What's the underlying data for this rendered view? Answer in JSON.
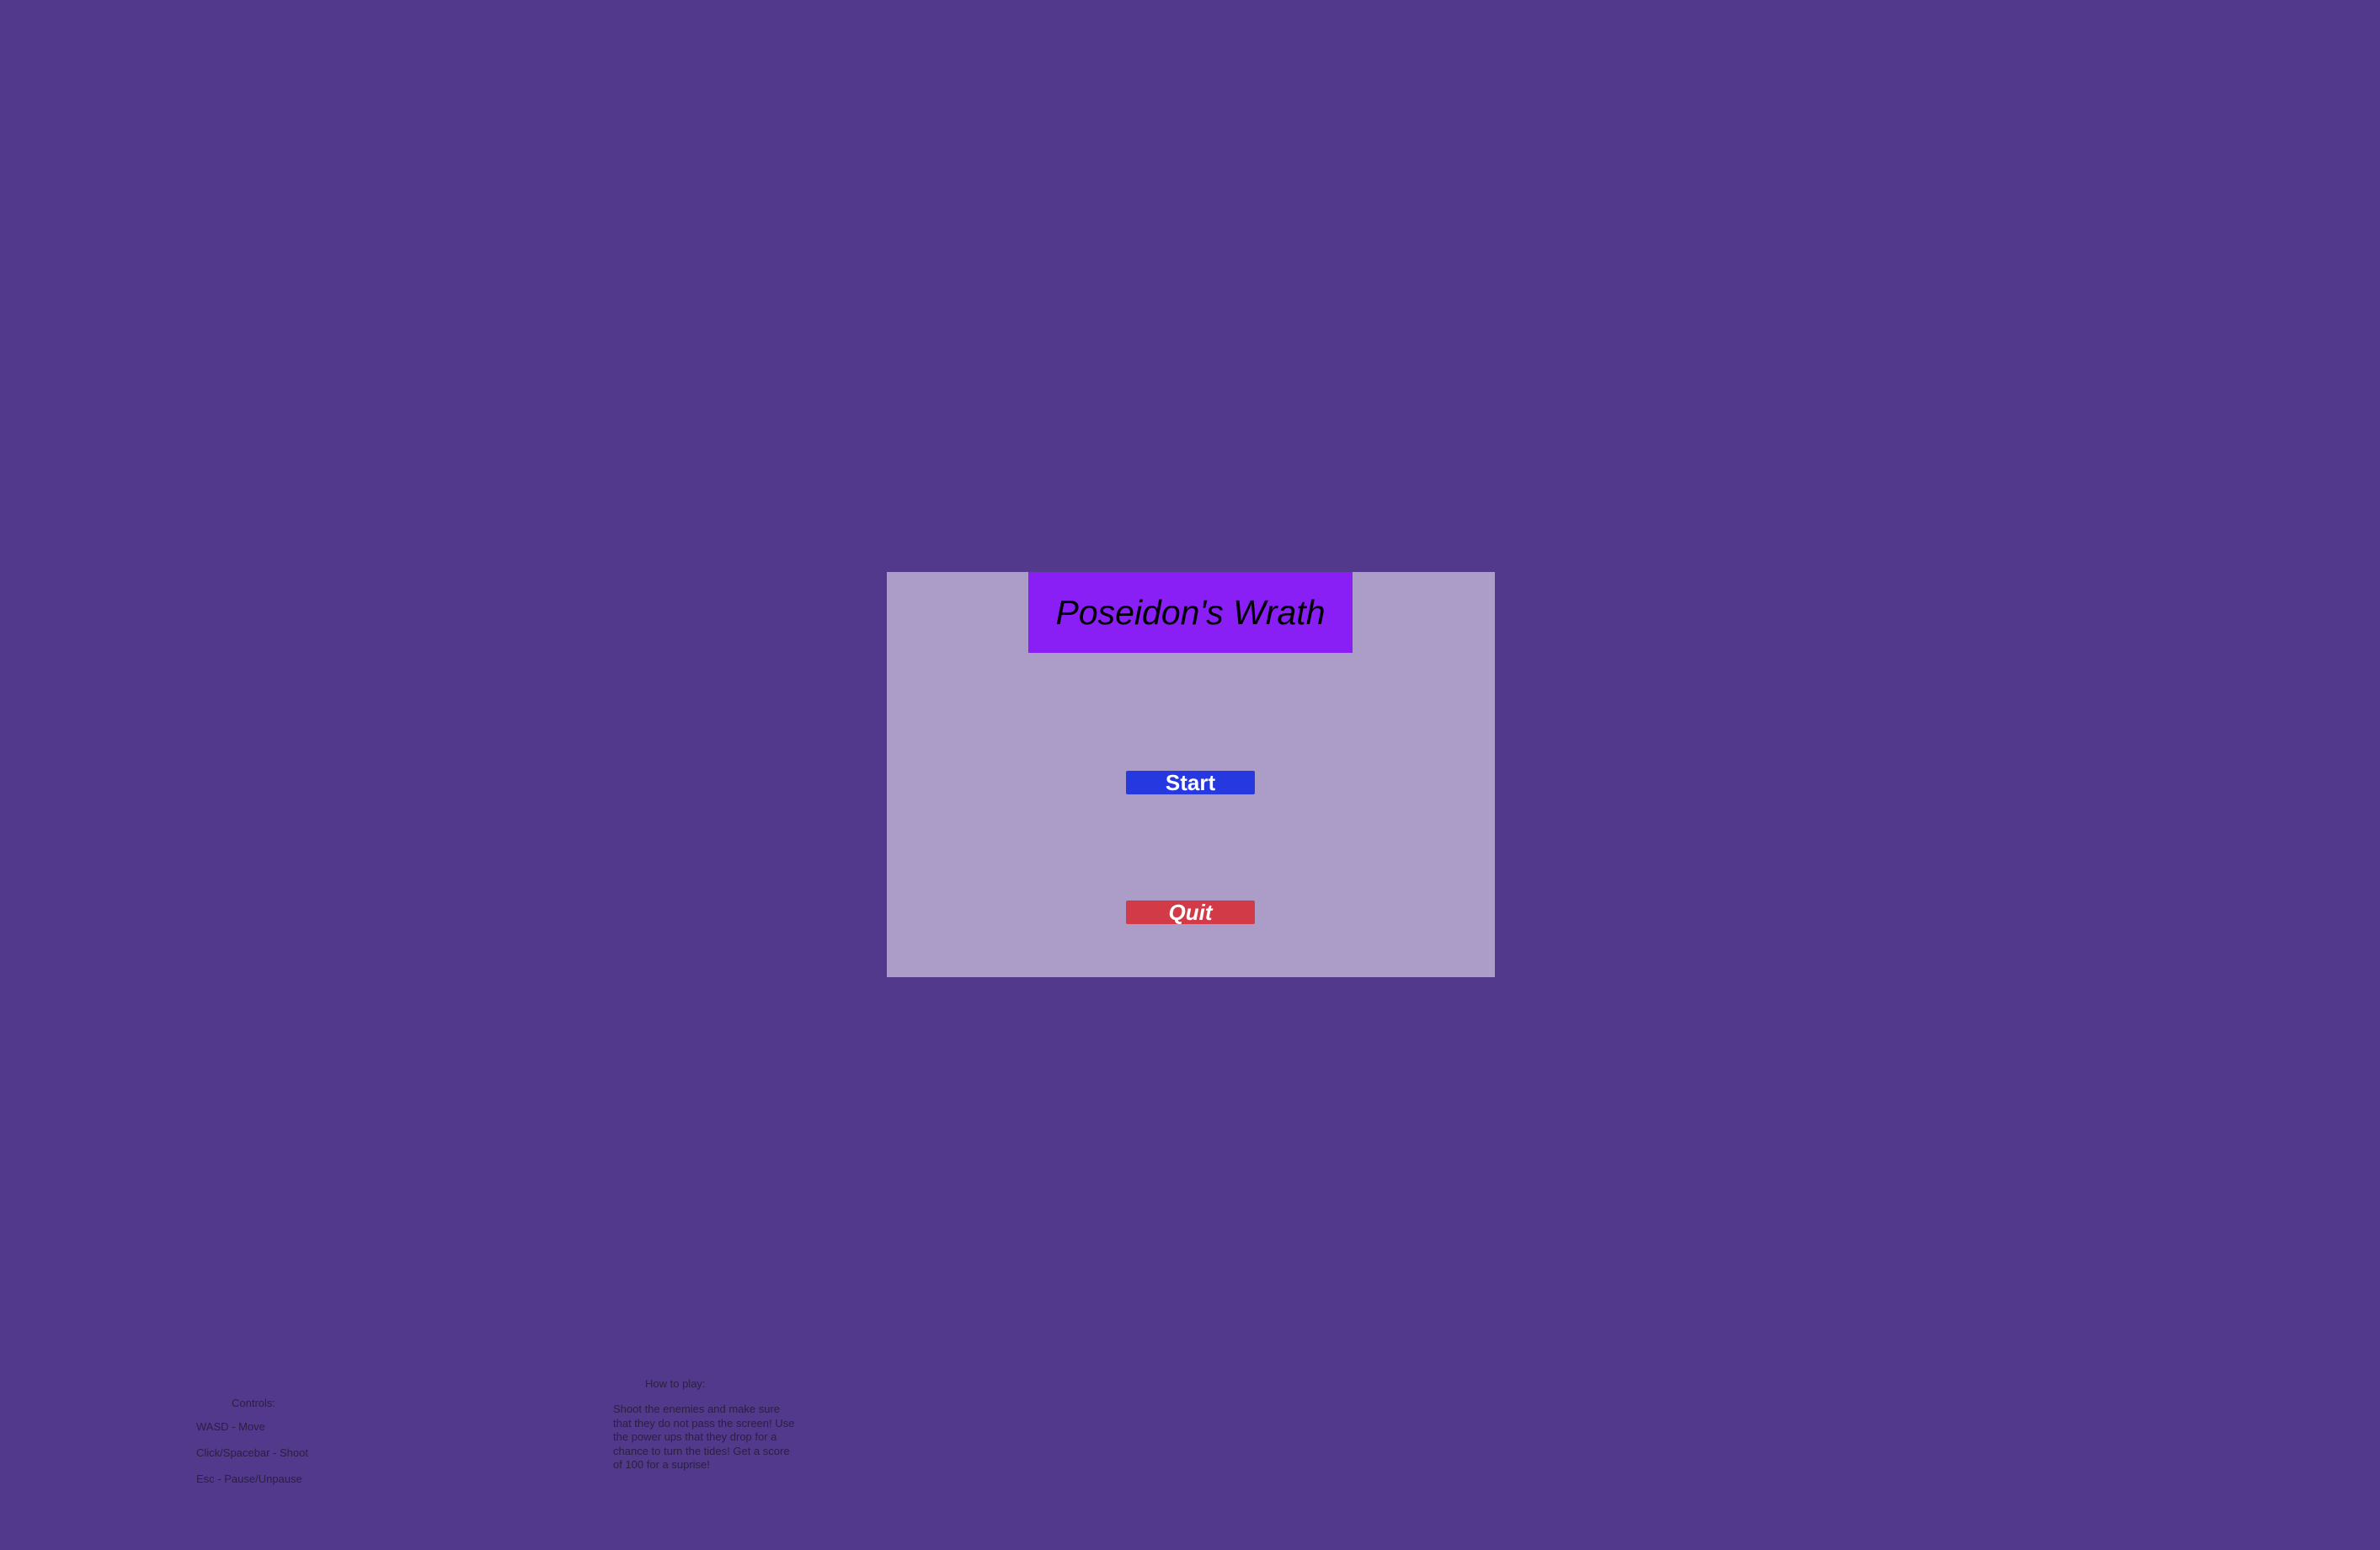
{
  "menu": {
    "title": "Poseidon's Wrath",
    "start_label": "Start",
    "quit_label": "Quit"
  },
  "controls": {
    "heading": "Controls:",
    "lines": [
      "WASD - Move",
      "Click/Spacebar - Shoot",
      "Esc - Pause/Unpause"
    ]
  },
  "how_to_play": {
    "heading": "How to play:",
    "text": "Shoot the enemies and make sure that they do not pass the screen! Use the power ups that they drop for a chance to turn the tides! Get a score of 100 for a suprise!"
  },
  "colors": {
    "background": "#52398c",
    "panel": "#ac9cc8",
    "title_box": "#8a1ff5",
    "start_button": "#2638e0",
    "quit_button": "#d23a48"
  }
}
